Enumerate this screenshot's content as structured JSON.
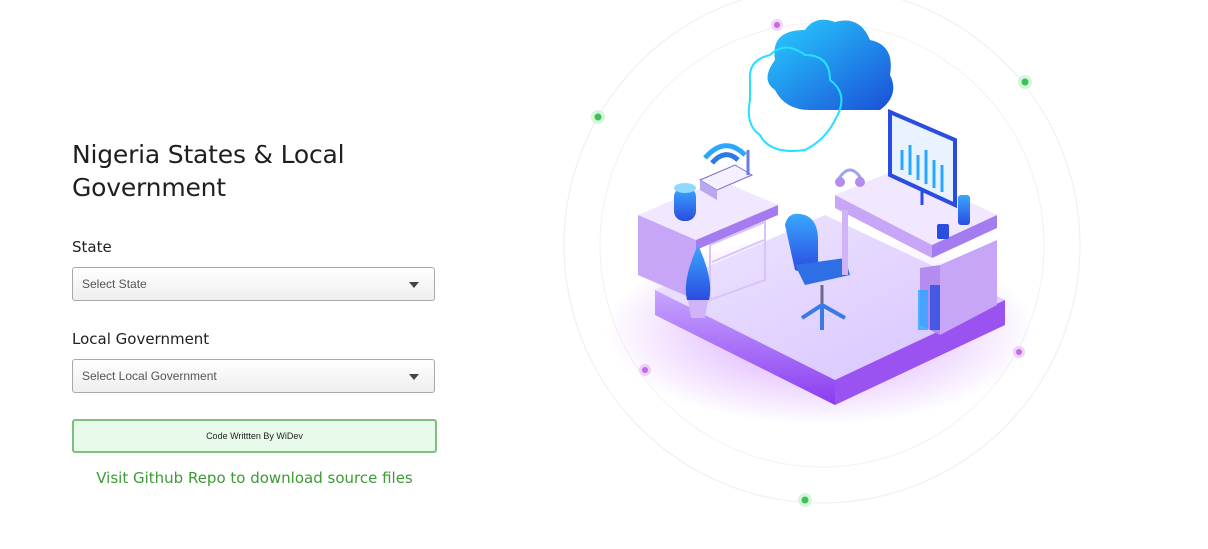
{
  "page": {
    "title": "Nigeria States & Local Government"
  },
  "form": {
    "state_label": "State",
    "state_select_value": "Select State",
    "lga_label": "Local Government",
    "lga_select_value": "Select Local Government"
  },
  "footer": {
    "credit_text": "Code Writtten By WiDev",
    "repo_link_text": "Visit Github Repo to download source files"
  },
  "colors": {
    "link_green": "#3d9b35",
    "credit_bg": "#e8fbea",
    "credit_border": "#7fbf7f",
    "illustration_purple": "#b48cf0",
    "illustration_blue": "#2a7be6"
  },
  "illustration": {
    "icons": [
      "cloud-icon",
      "wifi-router-icon",
      "monitor-chart-icon",
      "office-chair-icon",
      "desk-icon",
      "plant-icon",
      "headset-icon",
      "cup-icon"
    ]
  }
}
